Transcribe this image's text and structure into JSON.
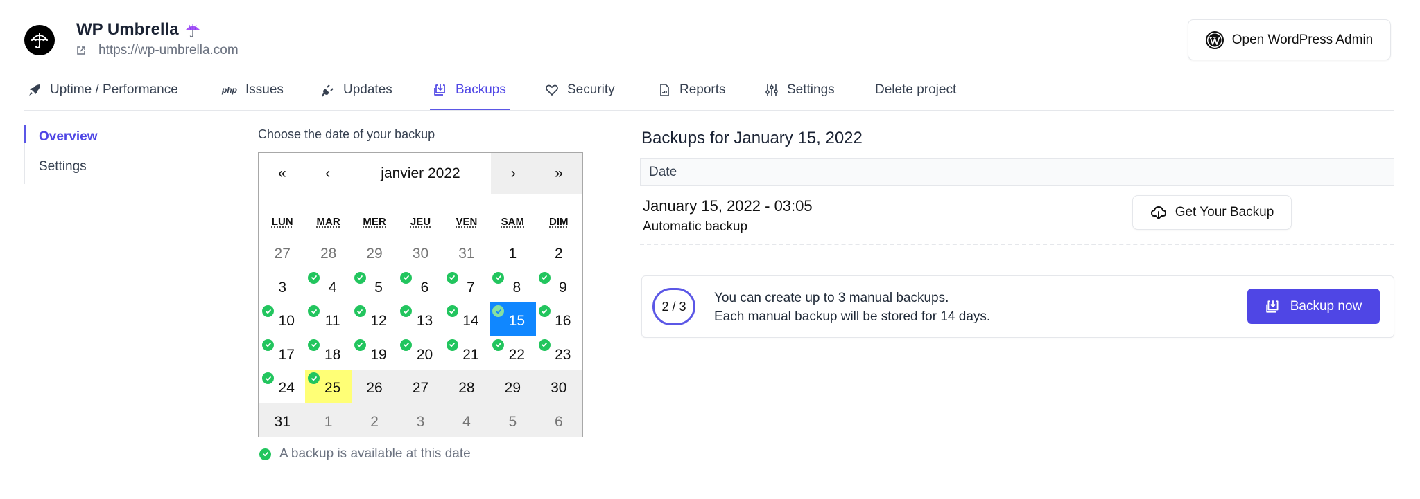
{
  "header": {
    "project_name": "WP Umbrella",
    "project_emoji": "umbrella-emoji",
    "project_url": "https://wp-umbrella.com",
    "open_admin_label": "Open WordPress Admin"
  },
  "tabs": [
    {
      "label": "Uptime / Performance",
      "icon": "rocket-icon",
      "active": false
    },
    {
      "label": "Issues",
      "icon": "php-icon",
      "icon_text": "php",
      "active": false
    },
    {
      "label": "Updates",
      "icon": "plug-icon",
      "active": false
    },
    {
      "label": "Backups",
      "icon": "backup-icon",
      "active": true
    },
    {
      "label": "Security",
      "icon": "heart-icon",
      "active": false
    },
    {
      "label": "Reports",
      "icon": "report-file-icon",
      "active": false
    },
    {
      "label": "Settings",
      "icon": "sliders-icon",
      "active": false
    },
    {
      "label": "Delete project",
      "icon": null,
      "active": false
    }
  ],
  "sidebar": {
    "items": [
      {
        "label": "Overview",
        "active": true
      },
      {
        "label": "Settings",
        "active": false
      }
    ]
  },
  "calendar": {
    "label": "Choose the date of your backup",
    "nav": {
      "first": "«",
      "prev": "‹",
      "month_label": "janvier 2022",
      "next": "›",
      "last": "»"
    },
    "weekdays": [
      "LUN",
      "MAR",
      "MER",
      "JEU",
      "VEN",
      "SAM",
      "DIM"
    ],
    "days": [
      {
        "n": "27",
        "neighbor": true
      },
      {
        "n": "28",
        "neighbor": true
      },
      {
        "n": "29",
        "neighbor": true
      },
      {
        "n": "30",
        "neighbor": true
      },
      {
        "n": "31",
        "neighbor": true
      },
      {
        "n": "1"
      },
      {
        "n": "2"
      },
      {
        "n": "3"
      },
      {
        "n": "4",
        "backup": true
      },
      {
        "n": "5",
        "backup": true
      },
      {
        "n": "6",
        "backup": true
      },
      {
        "n": "7",
        "backup": true
      },
      {
        "n": "8",
        "backup": true
      },
      {
        "n": "9",
        "backup": true
      },
      {
        "n": "10",
        "backup": true
      },
      {
        "n": "11",
        "backup": true
      },
      {
        "n": "12",
        "backup": true
      },
      {
        "n": "13",
        "backup": true
      },
      {
        "n": "14",
        "backup": true
      },
      {
        "n": "15",
        "backup": true,
        "selected": true
      },
      {
        "n": "16",
        "backup": true
      },
      {
        "n": "17",
        "backup": true
      },
      {
        "n": "18",
        "backup": true
      },
      {
        "n": "19",
        "backup": true
      },
      {
        "n": "20",
        "backup": true
      },
      {
        "n": "21",
        "backup": true
      },
      {
        "n": "22",
        "backup": true
      },
      {
        "n": "23",
        "backup": true
      },
      {
        "n": "24",
        "backup": true
      },
      {
        "n": "25",
        "backup": true,
        "today": true
      },
      {
        "n": "26",
        "disabled": true
      },
      {
        "n": "27",
        "disabled": true
      },
      {
        "n": "28",
        "disabled": true
      },
      {
        "n": "29",
        "disabled": true
      },
      {
        "n": "30",
        "disabled": true
      },
      {
        "n": "31",
        "disabled": true
      },
      {
        "n": "1",
        "neighbor": true,
        "disabled": true
      },
      {
        "n": "2",
        "neighbor": true,
        "disabled": true
      },
      {
        "n": "3",
        "neighbor": true,
        "disabled": true
      },
      {
        "n": "4",
        "neighbor": true,
        "disabled": true
      },
      {
        "n": "5",
        "neighbor": true,
        "disabled": true
      },
      {
        "n": "6",
        "neighbor": true,
        "disabled": true
      }
    ],
    "legend": "A backup is available at this date"
  },
  "backups": {
    "title": "Backups for January 15, 2022",
    "column_header": "Date",
    "rows": [
      {
        "date": "January 15, 2022 - 03:05",
        "type": "Automatic backup",
        "action_label": "Get Your Backup"
      }
    ]
  },
  "manual": {
    "quota": "2 / 3",
    "line1": "You can create up to 3 manual backups.",
    "line2": "Each manual backup will be stored for 14 days.",
    "button_label": "Backup now"
  },
  "colors": {
    "accent": "#4f46e5",
    "success": "#22c55e",
    "selected_day": "#1087ff",
    "today_day": "#ffff76"
  }
}
